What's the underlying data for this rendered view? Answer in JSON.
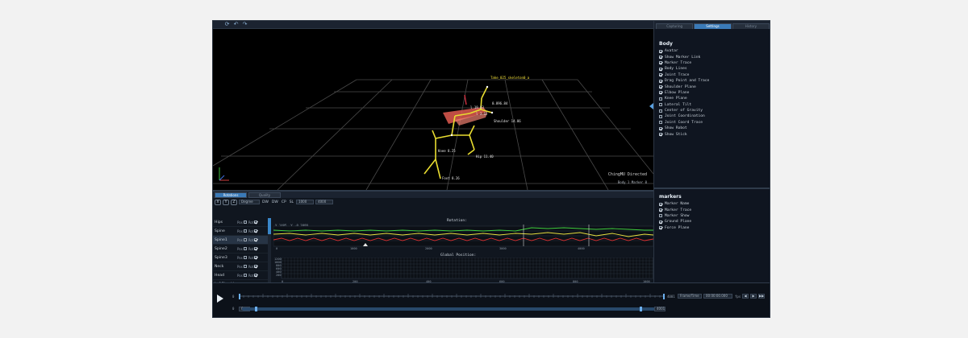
{
  "toolbar": {
    "icons": [
      "sync-icon",
      "undo-icon",
      "redo-icon"
    ]
  },
  "viewport": {
    "bone_title": "Take_025_skeleton0_a",
    "mode_text": "ChingMU Directed",
    "counts_text": "Body 1  Marker 0",
    "bone_labels": [
      "0.896.84",
      "l 19.83",
      "Shoulder 14.86",
      "l 3.12",
      "Knee 8.25",
      "Hip 11.40",
      "Foot 8.26"
    ]
  },
  "right_panel": {
    "tabs": [
      "Capturing",
      "Settings",
      "History"
    ],
    "active_tab": 1,
    "body_title": "Body",
    "body_options": [
      {
        "label": "Avatar",
        "checked": true
      },
      {
        "label": "Show Marker Link",
        "checked": true
      },
      {
        "label": "Marker Trace",
        "checked": true
      },
      {
        "label": "Body Lines",
        "checked": true
      },
      {
        "label": "Joint Trace",
        "checked": true
      },
      {
        "label": "Drag Point and Trace",
        "checked": true
      },
      {
        "label": "Shoulder Plane",
        "checked": true
      },
      {
        "label": "Elbow Plane",
        "checked": true
      },
      {
        "label": "Knee Plane",
        "checked": false
      },
      {
        "label": "Lateral Tilt",
        "checked": false
      },
      {
        "label": "Center of Gravity",
        "checked": false
      },
      {
        "label": "Joint Coordination",
        "checked": false
      },
      {
        "label": "Joint Coord Trace",
        "checked": false
      },
      {
        "label": "Show Robot",
        "checked": true
      },
      {
        "label": "Show Stick",
        "checked": true
      }
    ],
    "markers_title": "markers",
    "marker_options": [
      {
        "label": "Marker Name",
        "checked": true
      },
      {
        "label": "Marker Trace",
        "checked": true
      },
      {
        "label": "Marker Show",
        "checked": false
      },
      {
        "label": "Ground Plane",
        "checked": true
      },
      {
        "label": "Force Plane",
        "checked": true
      }
    ]
  },
  "graph_panel": {
    "tabs": [
      "Rotations",
      "Quality"
    ],
    "active_tab": 0,
    "axis_buttons": [
      "X",
      "Y",
      "Z"
    ],
    "mode_select": "Degree",
    "tool_icons": [
      "DW",
      "DW",
      "CP",
      "SL"
    ],
    "field_start": "1000",
    "field_end": "4000",
    "joints": [
      {
        "name": "Hips",
        "pos": "Pos",
        "rot": "Rot",
        "selected": false
      },
      {
        "name": "Spine",
        "pos": "Pos",
        "rot": "Rot",
        "selected": false
      },
      {
        "name": "Spine1",
        "pos": "Pos",
        "rot": "Rot",
        "selected": true
      },
      {
        "name": "Spine2",
        "pos": "Pos",
        "rot": "Rot",
        "selected": false
      },
      {
        "name": "Spine3",
        "pos": "Pos",
        "rot": "Rot",
        "selected": false
      },
      {
        "name": "Neck",
        "pos": "Pos",
        "rot": "Rot",
        "selected": false
      },
      {
        "name": "Head",
        "pos": "Pos",
        "rot": "Rot",
        "selected": false
      },
      {
        "name": "LeftShoulder",
        "pos": "Pos",
        "rot": "Rot",
        "selected": false
      }
    ],
    "rotation_title": "Rotation:",
    "rotation_readout": "X 1405, Y -0.3099",
    "global_title": "Global Position:",
    "x_ticks": [
      "0",
      "1000",
      "2000",
      "3000",
      "4000"
    ],
    "global_x_ticks": [
      "0",
      "200",
      "400",
      "600",
      "800",
      "1000"
    ],
    "global_y_ticks": [
      "1200",
      "1000",
      "800",
      "600",
      "400",
      "200"
    ]
  },
  "timeline": {
    "frame_label_top": "0",
    "frame_label_bottom": "0",
    "start_field": "0",
    "end_field": "4001",
    "end_label": "4001",
    "mode_select": "Frame/Time",
    "time_field": "00:00:00.000",
    "fps_label": "fps",
    "buttons": [
      "◀",
      "▶",
      "▶▶"
    ]
  }
}
